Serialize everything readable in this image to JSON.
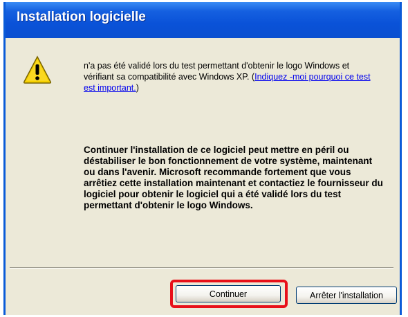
{
  "window": {
    "title": "Installation logicielle"
  },
  "icon": {
    "name": "warning-icon",
    "color": "#f5d000"
  },
  "message": {
    "text": "n'a pas été validé lors du test permettant d'obtenir le logo Windows et vérifiant sa compatibilité avec Windows XP. (",
    "link": "Indiquez -moi pourquoi ce test est important.",
    "suffix": ")"
  },
  "warning_text": "Continuer l'installation de ce logiciel peut mettre en péril ou déstabiliser le bon fonctionnement de votre système, maintenant ou dans l'avenir. Microsoft recommande fortement que vous arrêtiez cette installation maintenant et contactiez le fournisseur du logiciel pour obtenir le logiciel qui a été validé lors du test permettant d'obtenir le logo Windows.",
  "buttons": {
    "continue_label": "Continuer",
    "stop_label": "Arrêter l'installation"
  },
  "colors": {
    "titlebar": "#0a52d8",
    "dialog_bg": "#ece9d8",
    "highlight": "#e8101a"
  }
}
